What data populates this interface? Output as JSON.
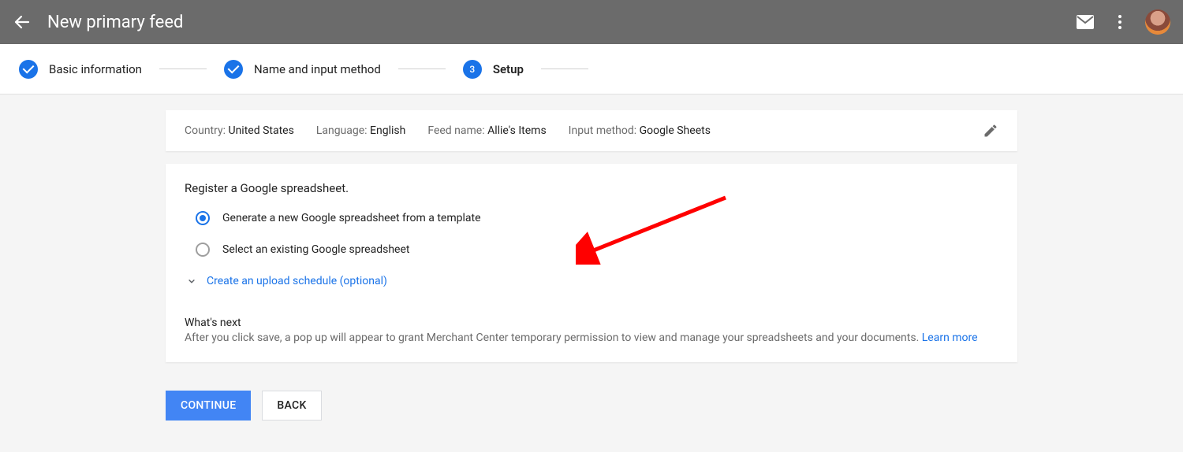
{
  "header": {
    "title": "New primary feed"
  },
  "stepper": {
    "step1": "Basic information",
    "step2": "Name and input method",
    "step3_number": "3",
    "step3": "Setup"
  },
  "summary": {
    "country_k": "Country: ",
    "country_v": "United States",
    "language_k": "Language: ",
    "language_v": "English",
    "feedname_k": "Feed name: ",
    "feedname_v": "Allie's Items",
    "inputmethod_k": "Input method: ",
    "inputmethod_v": "Google Sheets"
  },
  "setup": {
    "section_title": "Register a Google spreadsheet.",
    "option1": "Generate a new Google spreadsheet from a template",
    "option2": "Select an existing Google spreadsheet",
    "expand_link": "Create an upload schedule (optional)",
    "whats_next_title": "What's next",
    "whats_next_body": "After you click save, a pop up will appear to grant Merchant Center temporary permission to view and manage your spreadsheets and your documents. ",
    "learn_more": "Learn more"
  },
  "buttons": {
    "continue": "CONTINUE",
    "back": "BACK"
  }
}
